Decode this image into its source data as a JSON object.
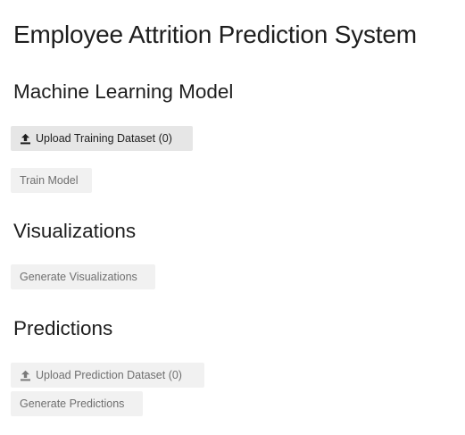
{
  "app": {
    "title": "Employee Attrition Prediction System"
  },
  "sections": {
    "model": {
      "heading": "Machine Learning Model",
      "upload_label": "Upload Training Dataset (0)",
      "train_label": "Train Model"
    },
    "visualizations": {
      "heading": "Visualizations",
      "generate_label": "Generate Visualizations"
    },
    "predictions": {
      "heading": "Predictions",
      "upload_label": "Upload Prediction Dataset (0)",
      "generate_label": "Generate Predictions"
    }
  },
  "icons": {
    "upload": "upload-icon"
  },
  "colors": {
    "enabled_button_bg": "#e6e6e6",
    "disabled_button_bg": "#f1f1f1",
    "enabled_text": "#1f1f1f",
    "disabled_text": "#6f6f6f"
  }
}
